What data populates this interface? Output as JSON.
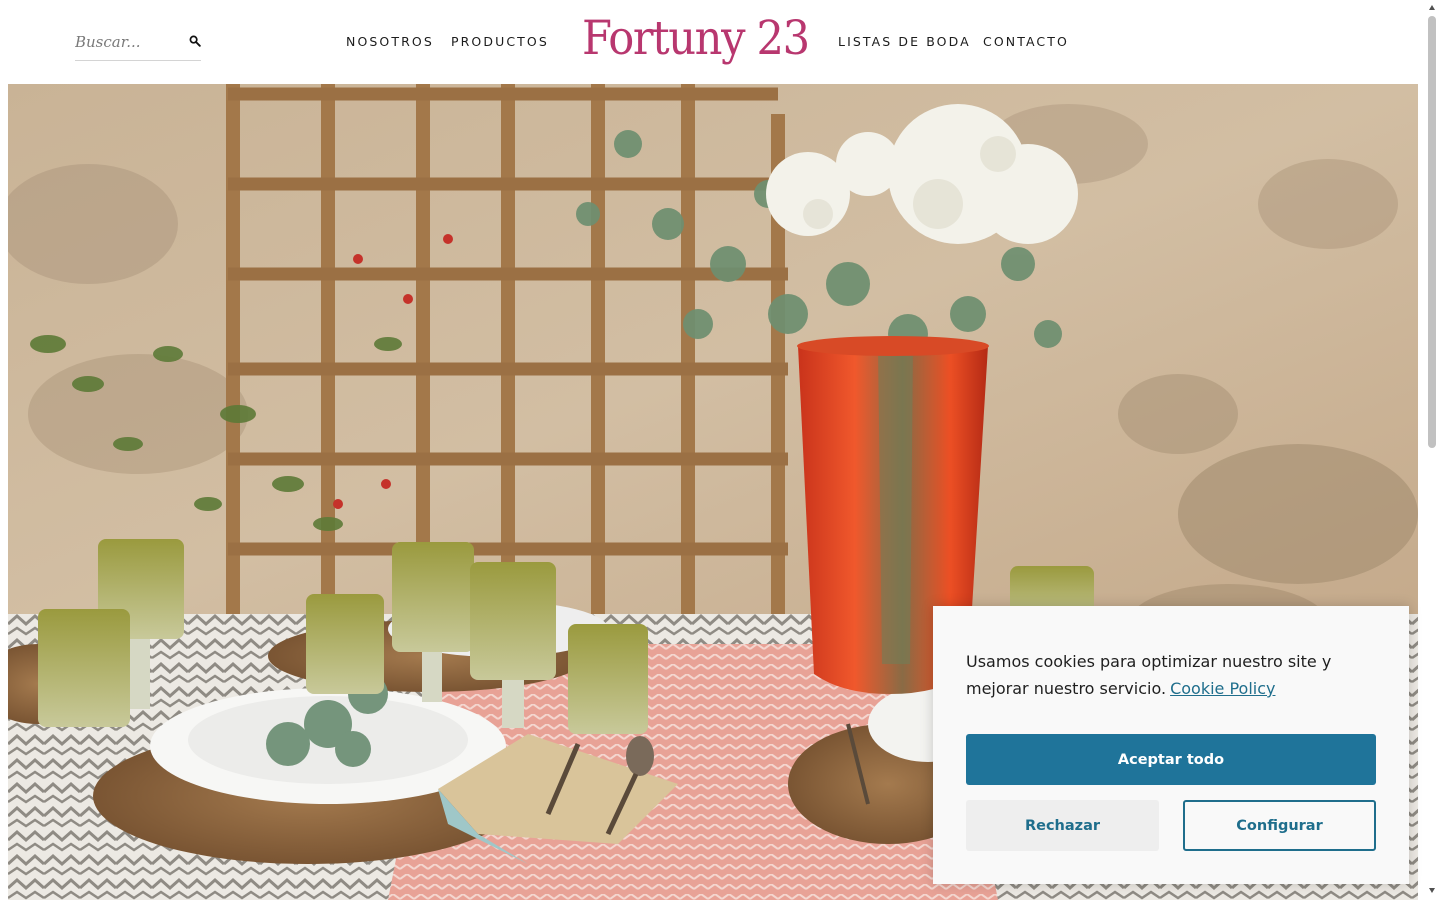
{
  "header": {
    "search": {
      "placeholder": "Buscar..."
    },
    "nav": {
      "nosotros": "NOSOTROS",
      "productos": "PRODUCTOS",
      "listas": "LISTAS DE BODA",
      "contacto": "CONTACTO"
    },
    "logo": "Fortuny 23"
  },
  "hero": {
    "icon": "table-setting-photo"
  },
  "cookie": {
    "message": "Usamos cookies para optimizar nuestro site y mejorar nuestro servicio.",
    "policy_link": "Cookie Policy",
    "accept": "Aceptar todo",
    "reject": "Rechazar",
    "configure": "Configurar"
  },
  "colors": {
    "logo": "#b8376f",
    "primary_button": "#1f749a",
    "link": "#1f6e8c"
  }
}
